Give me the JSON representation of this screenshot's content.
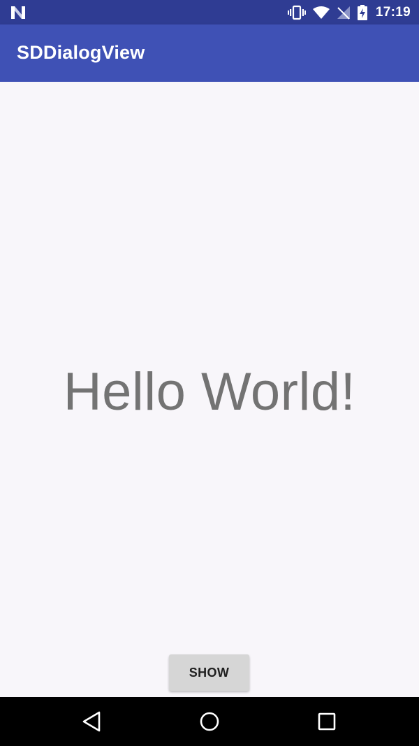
{
  "status_bar": {
    "time": "17:19",
    "left_icon": "android-n-notification-icon",
    "icons": [
      "vibrate-icon",
      "wifi-icon",
      "no-signal-icon",
      "battery-charging-icon"
    ]
  },
  "app_bar": {
    "title": "SDDialogView",
    "color": "#3f51b5"
  },
  "main": {
    "hello_text": "Hello World!",
    "show_button_label": "SHOW"
  },
  "nav_bar": {
    "buttons": [
      "back-icon",
      "home-icon",
      "recent-apps-icon"
    ]
  }
}
